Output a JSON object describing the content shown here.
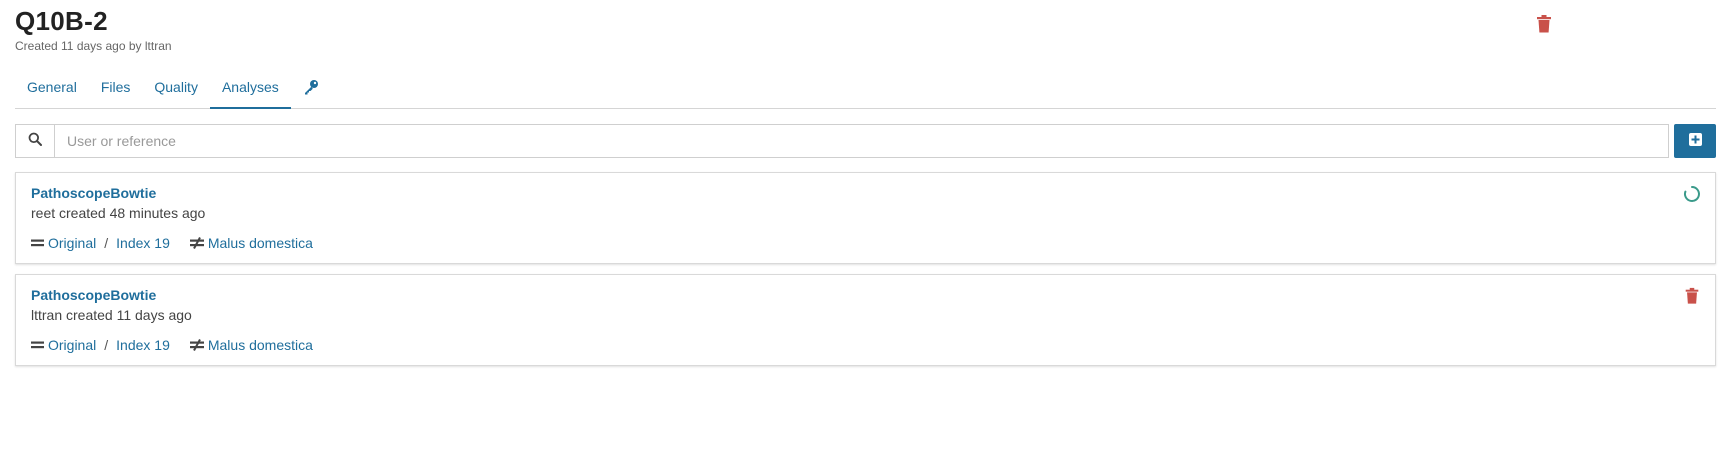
{
  "header": {
    "title": "Q10B-2",
    "subtitle": "Created 11 days ago by lttran",
    "delete_icon": "trash-icon"
  },
  "tabs": [
    {
      "label": "General"
    },
    {
      "label": "Files"
    },
    {
      "label": "Quality"
    },
    {
      "label": "Analyses",
      "active": true
    }
  ],
  "tab_icon": "key-icon",
  "search": {
    "placeholder": "User or reference",
    "value": "",
    "icon": "search-icon",
    "add_icon": "plus-square-icon"
  },
  "analyses": [
    {
      "algorithm": "PathoscopeBowtie",
      "created": "reet created 48 minutes ago",
      "reference": "Original",
      "separator": "/",
      "index": "Index 19",
      "subtraction": "Malus domestica",
      "status_icon": "loader-icon"
    },
    {
      "algorithm": "PathoscopeBowtie",
      "created": "lttran created 11 days ago",
      "reference": "Original",
      "separator": "/",
      "index": "Index 19",
      "subtraction": "Malus domestica",
      "status_icon": "trash-icon"
    }
  ],
  "colors": {
    "primary": "#1f6e9c",
    "danger": "#c9514a",
    "loader": "#3a9a8a"
  }
}
